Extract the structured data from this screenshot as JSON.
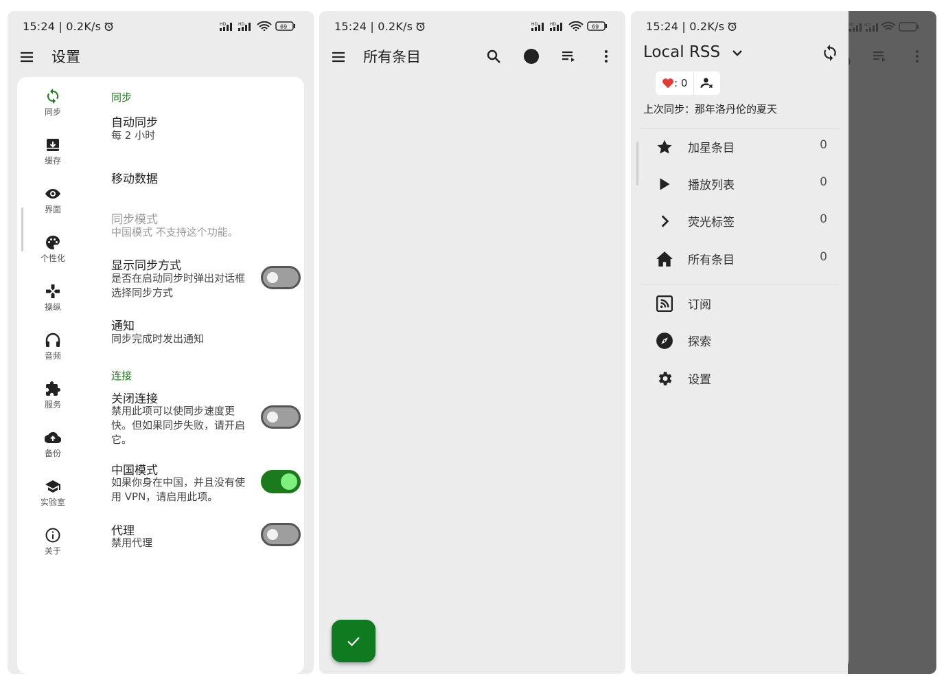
{
  "status": {
    "time": "15:24 | 0.2K/s",
    "battery": "69",
    "signal_tag": "HD"
  },
  "settings_screen": {
    "title": "设置",
    "nav": [
      {
        "label": "同步",
        "icon": "sync-icon",
        "active": true
      },
      {
        "label": "缓存",
        "icon": "archive-icon"
      },
      {
        "label": "界面",
        "icon": "eye-icon"
      },
      {
        "label": "个性化",
        "icon": "palette-icon"
      },
      {
        "label": "操纵",
        "icon": "gamepad-icon"
      },
      {
        "label": "音频",
        "icon": "headphones-icon"
      },
      {
        "label": "服务",
        "icon": "puzzle-icon"
      },
      {
        "label": "备份",
        "icon": "cloud-upload-icon"
      },
      {
        "label": "实验室",
        "icon": "school-icon"
      },
      {
        "label": "关于",
        "icon": "info-icon"
      }
    ],
    "sections": {
      "sync_header": "同步",
      "connection_header": "连接"
    },
    "items": {
      "auto_sync": {
        "title": "自动同步",
        "sub": "每 2 小时"
      },
      "mobile_data": {
        "title": "移动数据"
      },
      "sync_mode": {
        "title": "同步模式",
        "sub": "中国模式 不支持这个功能。"
      },
      "show_sync_method": {
        "title": "显示同步方式",
        "sub": "是否在启动同步时弹出对话框选择同步方式",
        "enabled": false
      },
      "notification": {
        "title": "通知",
        "sub": "同步完成时发出通知"
      },
      "close_connection": {
        "title": "关闭连接",
        "sub": "禁用此项可以使同步速度更快。但如果同步失败，请开启它。",
        "enabled": false
      },
      "china_mode": {
        "title": "中国模式",
        "sub": "如果你身在中国，并且没有使用 VPN，请启用此项。",
        "enabled": true
      },
      "proxy": {
        "title": "代理",
        "sub": "禁用代理",
        "enabled": false
      }
    }
  },
  "list_screen": {
    "title": "所有条目",
    "actions": [
      "search-icon",
      "filter-dot-icon",
      "playlist-icon",
      "more-vert-icon"
    ],
    "fab_icon": "check-icon"
  },
  "drawer_screen": {
    "title": "Local RSS",
    "heart_count": ": 0",
    "last_sync": "上次同步：那年洛丹伦的夏天",
    "items": [
      {
        "label": "加星条目",
        "count": "0",
        "icon": "star-icon"
      },
      {
        "label": "播放列表",
        "count": "0",
        "icon": "play-icon"
      },
      {
        "label": "荧光标签",
        "count": "0",
        "icon": "chevron-right-icon"
      },
      {
        "label": "所有条目",
        "count": "0",
        "icon": "home-icon"
      }
    ],
    "links": [
      {
        "label": "订阅",
        "icon": "rss-icon"
      },
      {
        "label": "探索",
        "icon": "compass-icon"
      },
      {
        "label": "设置",
        "icon": "gear-icon"
      }
    ]
  },
  "colors": {
    "accent": "#1b7a1b",
    "fab": "#0f7a1f",
    "toggle_on_knob": "#7ef07e",
    "scrim": "#5f5f5f"
  }
}
